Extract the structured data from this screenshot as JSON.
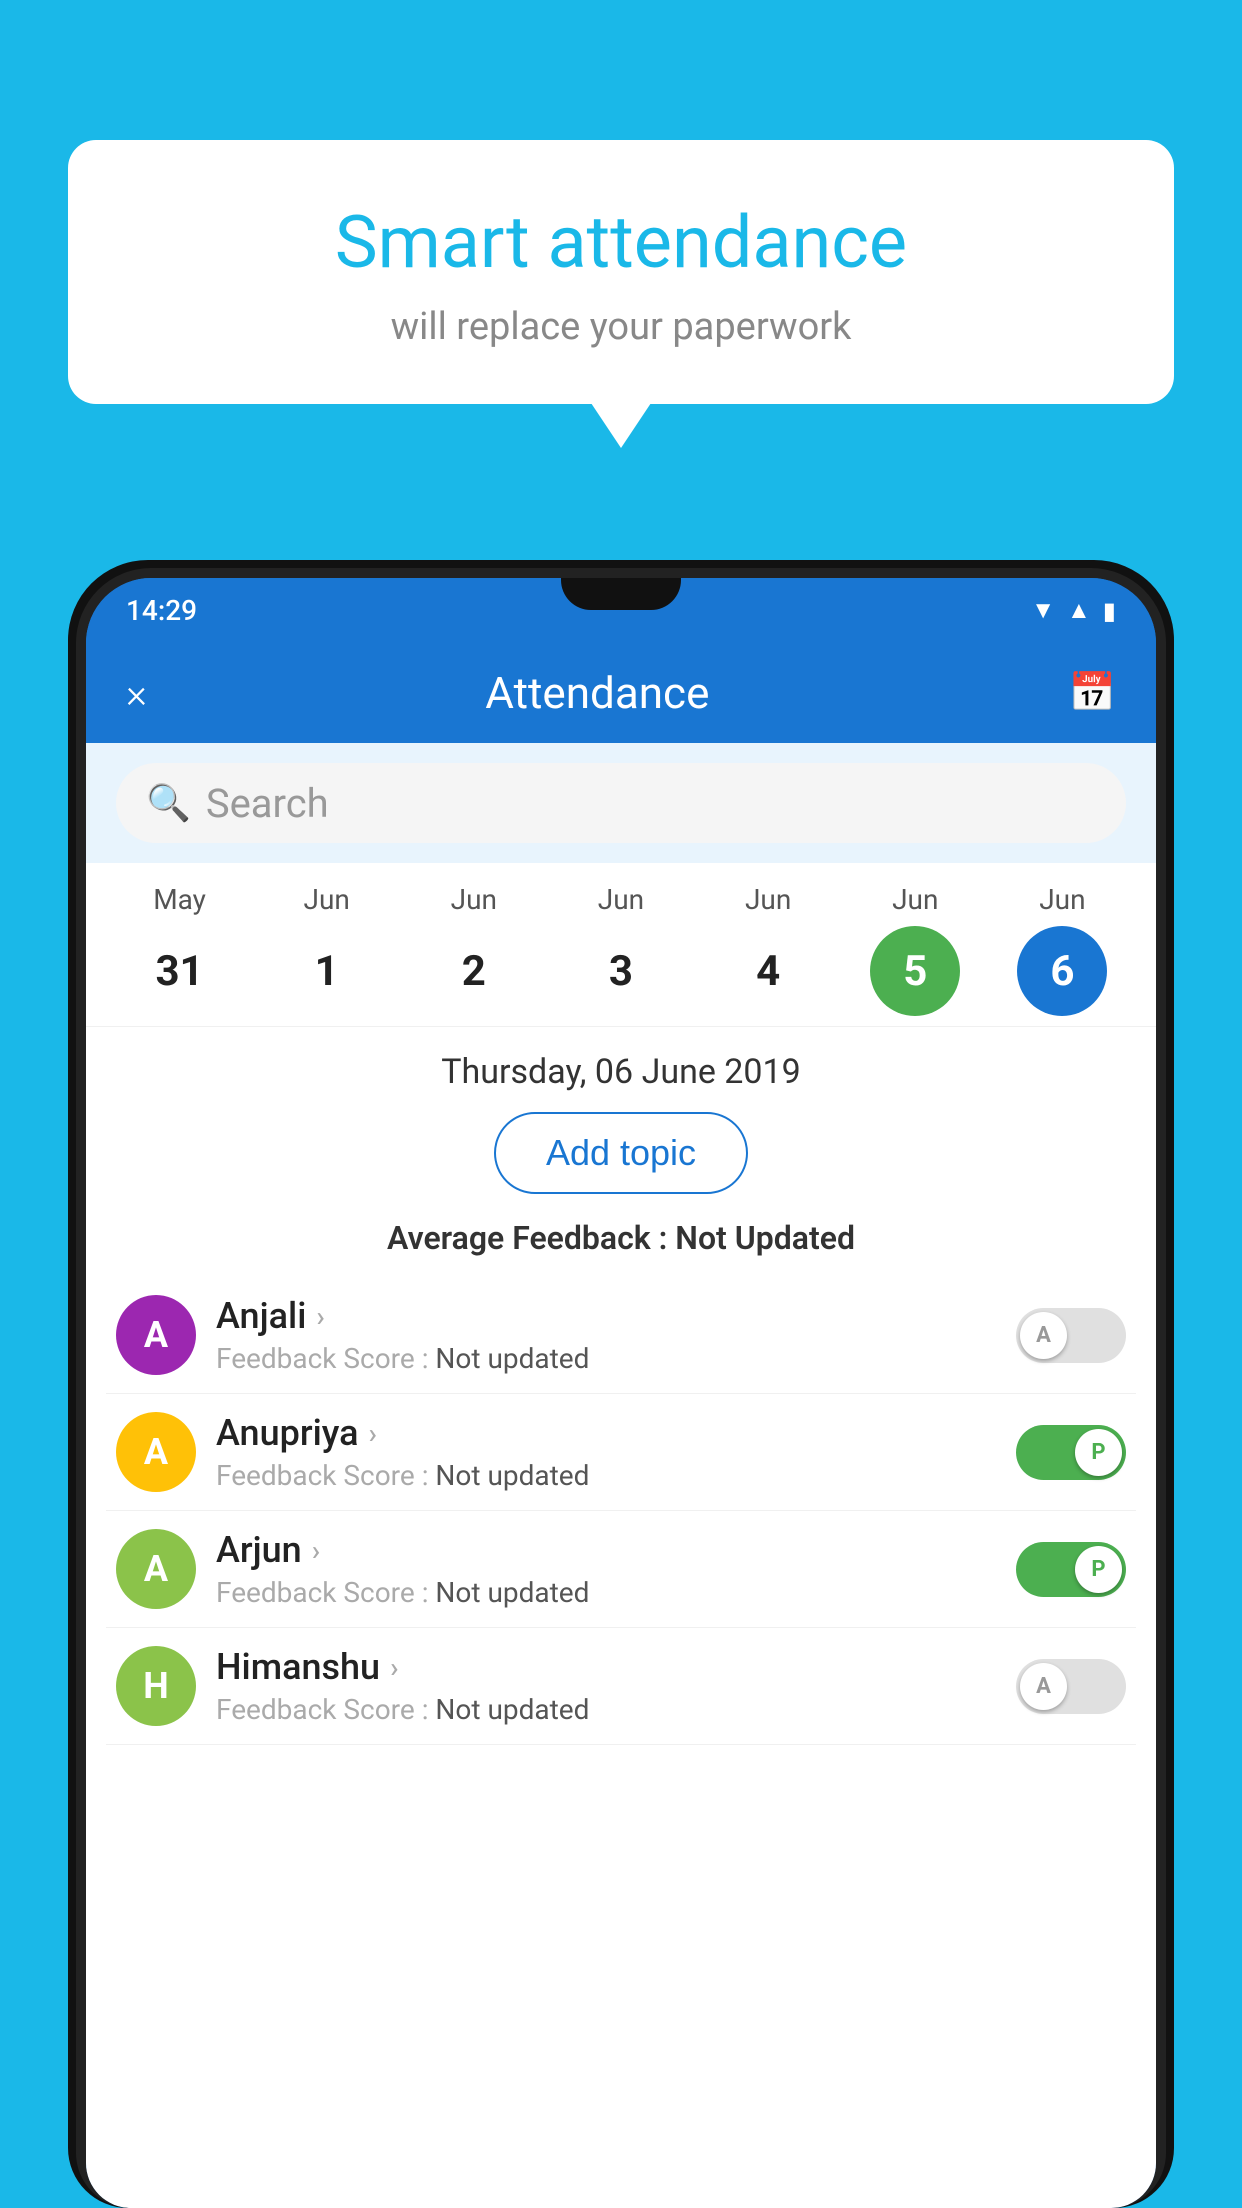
{
  "background_color": "#1ab8e8",
  "speech_bubble": {
    "title": "Smart attendance",
    "subtitle": "will replace your paperwork"
  },
  "status_bar": {
    "time": "14:29",
    "icons": [
      "wifi",
      "signal",
      "battery"
    ]
  },
  "app_header": {
    "title": "Attendance",
    "close_label": "×",
    "calendar_icon": "📅"
  },
  "search": {
    "placeholder": "Search"
  },
  "calendar": {
    "days": [
      {
        "month": "May",
        "date": "31",
        "highlight": ""
      },
      {
        "month": "Jun",
        "date": "1",
        "highlight": ""
      },
      {
        "month": "Jun",
        "date": "2",
        "highlight": ""
      },
      {
        "month": "Jun",
        "date": "3",
        "highlight": ""
      },
      {
        "month": "Jun",
        "date": "4",
        "highlight": ""
      },
      {
        "month": "Jun",
        "date": "5",
        "highlight": "green"
      },
      {
        "month": "Jun",
        "date": "6",
        "highlight": "blue"
      }
    ],
    "selected_date": "Thursday, 06 June 2019"
  },
  "add_topic_label": "Add topic",
  "avg_feedback_label": "Average Feedback :",
  "avg_feedback_value": "Not Updated",
  "students": [
    {
      "name": "Anjali",
      "initial": "A",
      "avatar_color": "#9c27b0",
      "feedback_label": "Feedback Score :",
      "feedback_value": "Not updated",
      "toggle_state": "off",
      "toggle_letter": "A"
    },
    {
      "name": "Anupriya",
      "initial": "A",
      "avatar_color": "#ffc107",
      "feedback_label": "Feedback Score :",
      "feedback_value": "Not updated",
      "toggle_state": "on",
      "toggle_letter": "P"
    },
    {
      "name": "Arjun",
      "initial": "A",
      "avatar_color": "#8bc34a",
      "feedback_label": "Feedback Score :",
      "feedback_value": "Not updated",
      "toggle_state": "on",
      "toggle_letter": "P"
    },
    {
      "name": "Himanshu",
      "initial": "H",
      "avatar_color": "#8bc34a",
      "feedback_label": "Feedback Score :",
      "feedback_value": "Not updated",
      "toggle_state": "off",
      "toggle_letter": "A"
    }
  ]
}
